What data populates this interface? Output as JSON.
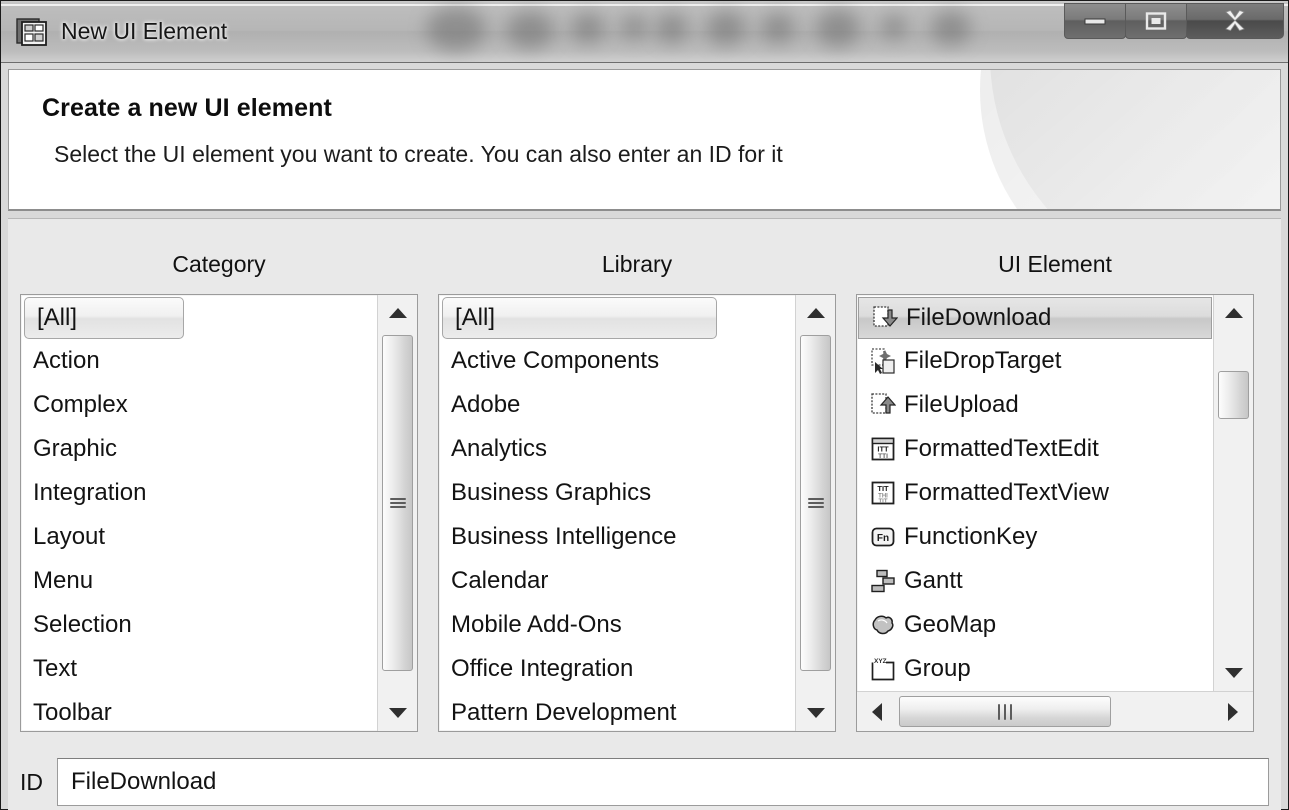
{
  "window": {
    "title": "New UI Element",
    "icon": "ui-element-icon",
    "controls": [
      {
        "name": "minimize-button",
        "glyph": "minimize"
      },
      {
        "name": "maximize-button",
        "glyph": "maximize"
      },
      {
        "name": "close-button",
        "glyph": "close"
      }
    ]
  },
  "header": {
    "title": "Create a new UI element",
    "subtitle": "Select the UI element you want to create. You can also enter an ID for it"
  },
  "columns": {
    "category": {
      "title": "Category",
      "selected": "[All]",
      "items": [
        "[All]",
        "Action",
        "Complex",
        "Graphic",
        "Integration",
        "Layout",
        "Menu",
        "Selection",
        "Text",
        "Toolbar"
      ]
    },
    "library": {
      "title": "Library",
      "selected": "[All]",
      "items": [
        "[All]",
        "Active Components",
        "Adobe",
        "Analytics",
        "Business Graphics",
        "Business Intelligence",
        "Calendar",
        "Mobile Add-Ons",
        "Office Integration",
        "Pattern Development"
      ]
    },
    "uielement": {
      "title": "UI Element",
      "selected": "FileDownload",
      "items": [
        {
          "label": "FileDownload",
          "icon": "file-download-icon"
        },
        {
          "label": "FileDropTarget",
          "icon": "file-drop-target-icon"
        },
        {
          "label": "FileUpload",
          "icon": "file-upload-icon"
        },
        {
          "label": "FormattedTextEdit",
          "icon": "formatted-text-edit-icon"
        },
        {
          "label": "FormattedTextView",
          "icon": "formatted-text-view-icon"
        },
        {
          "label": "FunctionKey",
          "icon": "function-key-icon"
        },
        {
          "label": "Gantt",
          "icon": "gantt-icon"
        },
        {
          "label": "GeoMap",
          "icon": "geomap-icon"
        },
        {
          "label": "Group",
          "icon": "group-icon"
        }
      ]
    }
  },
  "id_field": {
    "label": "ID",
    "value": "FileDownload",
    "placeholder": ""
  },
  "colors": {
    "window_chrome": "#d9d9d9",
    "header_bg": "#ffffff",
    "body_bg": "#e9e9e9",
    "list_bg": "#ffffff",
    "text": "#131313",
    "selection_full": "#d8d8d8",
    "border": "#9b9b9b"
  }
}
